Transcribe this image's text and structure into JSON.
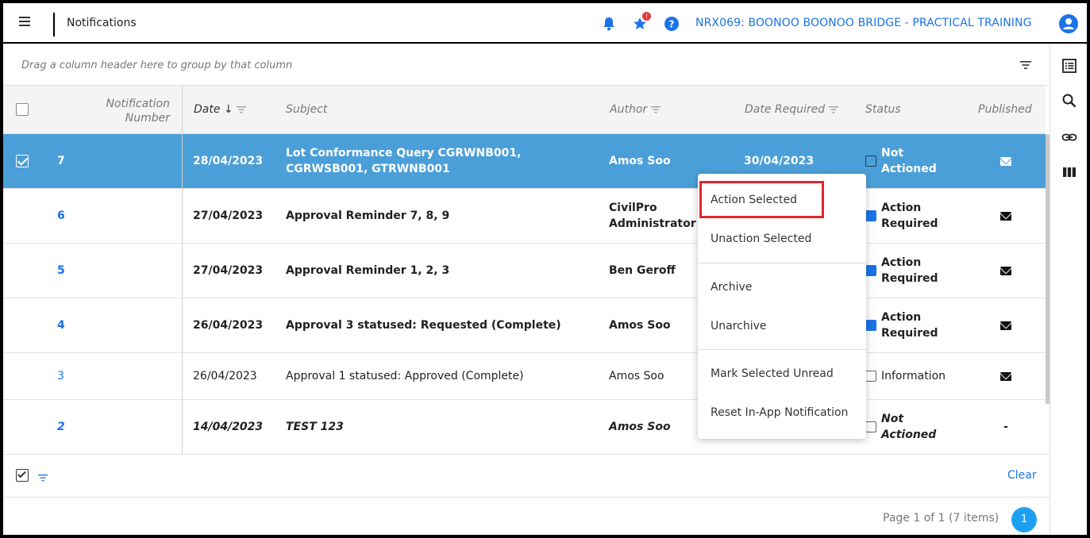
{
  "header": {
    "title": "Notifications",
    "notification_badge": "!",
    "project": "NRX069: BOONOO BOONOO BRIDGE - PRACTICAL TRAINING"
  },
  "group_panel": {
    "hint": "Drag a column header here to group by that column"
  },
  "columns": {
    "number": "Notification Number",
    "date": "Date",
    "subject": "Subject",
    "author": "Author",
    "date_required": "Date Required",
    "status": "Status",
    "published": "Published"
  },
  "rows": [
    {
      "number": "7",
      "date": "28/04/2023",
      "subject": "Lot Conformance Query CGRWNB001, CGRWSB001, GTRWNB001",
      "author": "Amos Soo",
      "date_required": "30/04/2023",
      "status": "Not Actioned",
      "published": "mail"
    },
    {
      "number": "6",
      "date": "27/04/2023",
      "subject": "Approval Reminder 7, 8, 9",
      "author": "CivilPro Administrator",
      "date_required": "",
      "status": "Action Required",
      "published": "mail"
    },
    {
      "number": "5",
      "date": "27/04/2023",
      "subject": "Approval Reminder 1, 2, 3",
      "author": "Ben Geroff",
      "date_required": "",
      "status": "Action Required",
      "published": "mail"
    },
    {
      "number": "4",
      "date": "26/04/2023",
      "subject": "Approval 3 statused: Requested (Complete)",
      "author": "Amos Soo",
      "date_required": "",
      "status": "Action Required",
      "published": "mail"
    },
    {
      "number": "3",
      "date": "26/04/2023",
      "subject": "Approval 1 statused: Approved (Complete)",
      "author": "Amos Soo",
      "date_required": "",
      "status": "Information",
      "published": "mail"
    },
    {
      "number": "2",
      "date": "14/04/2023",
      "subject": "TEST 123",
      "author": "Amos Soo",
      "date_required": "",
      "status": "Not Actioned",
      "published": "-"
    }
  ],
  "context_menu": {
    "items": [
      "Action Selected",
      "Unaction Selected",
      "Archive",
      "Unarchive",
      "Mark Selected Unread",
      "Reset In-App Notification"
    ]
  },
  "footer": {
    "clear": "Clear",
    "page_info": "Page 1 of 1 (7 items)",
    "current_page": "1"
  },
  "colors": {
    "accent": "#1a73e8",
    "selected_row": "#4b9fd8",
    "highlight": "#e0262d",
    "pager": "#1ea0f2"
  },
  "icons": [
    "menu-icon",
    "bell-icon",
    "star-icon",
    "help-icon",
    "user-icon",
    "filter-icon",
    "list-icon",
    "search-icon",
    "link-icon",
    "columns-icon",
    "mail-icon"
  ]
}
